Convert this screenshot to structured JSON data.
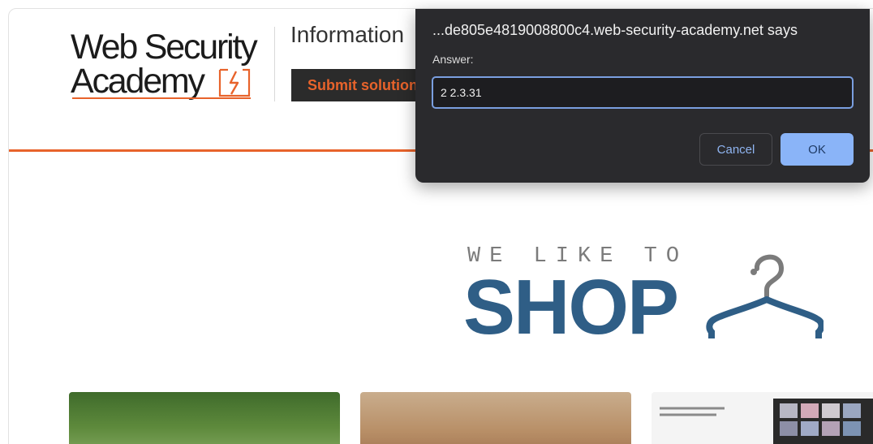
{
  "header": {
    "logo_line1": "Web Security",
    "logo_line2": "Academy",
    "info_title": "Information",
    "submit_label": "Submit solution"
  },
  "banner": {
    "tagline": "WE LIKE TO",
    "headline": "SHOP"
  },
  "dialog": {
    "title": "...de805e4819008800c4.web-security-academy.net says",
    "label": "Answer:",
    "input_value": "2 2.3.31",
    "cancel_label": "Cancel",
    "ok_label": "OK"
  },
  "colors": {
    "accent": "#e8632b",
    "shop_blue": "#2f5e86",
    "dialog_bg": "#2a2a2d",
    "ok_blue": "#8ab4f8"
  }
}
